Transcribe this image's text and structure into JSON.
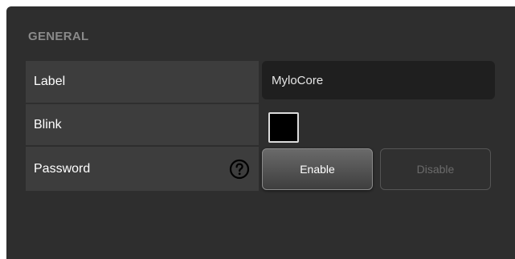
{
  "section": {
    "title": "GENERAL"
  },
  "rows": {
    "label": {
      "name": "Label",
      "value": "MyloCore"
    },
    "blink": {
      "name": "Blink",
      "swatch_color": "#000000"
    },
    "password": {
      "name": "Password",
      "help_icon": "question-mark-circle-icon",
      "enable_label": "Enable",
      "disable_label": "Disable"
    }
  }
}
